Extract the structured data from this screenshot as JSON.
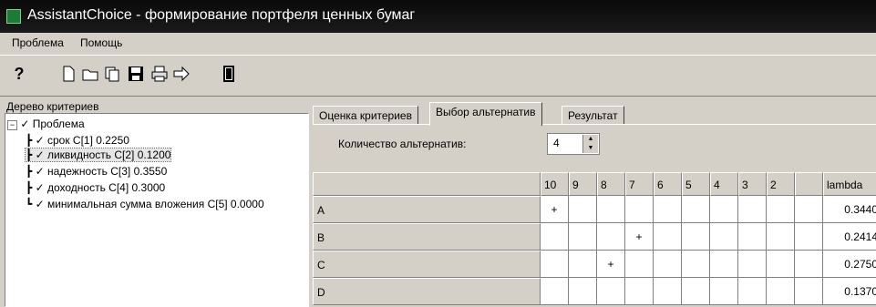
{
  "window": {
    "title": "AssistantChoice - формирование портфеля ценных бумаг"
  },
  "menu": [
    "Проблема",
    "Помощь"
  ],
  "toolbar": {
    "buttons": [
      "help-icon",
      "new-icon",
      "open-icon",
      "copy-icon",
      "save-icon",
      "print-icon",
      "export-icon",
      "exit-icon"
    ],
    "help_label": "?"
  },
  "tree_panel": {
    "title": "Дерево критериев",
    "root": "Проблема",
    "items": [
      "срок  C[1]  0.2250",
      "ликвидность  C[2]  0.1200",
      "надежность  C[3]  0.3550",
      "доходность  C[4]  0.3000",
      "минимальная сумма вложения  C[5]  0.0000"
    ],
    "selected_index": 1
  },
  "tabs": [
    "Оценка критериев",
    "Выбор альтернатив",
    "Результат"
  ],
  "active_tab": 1,
  "alternatives": {
    "count_label": "Количество альтернатив:",
    "count_value": "4",
    "columns": [
      "10",
      "9",
      "8",
      "7",
      "6",
      "5",
      "4",
      "3",
      "2",
      "",
      "lambda"
    ],
    "rows": [
      {
        "name": "A",
        "marks": [
          "+",
          "",
          "",
          "",
          "",
          "",
          "",
          "",
          "",
          "",
          "0.3440"
        ]
      },
      {
        "name": "B",
        "marks": [
          "",
          "",
          "",
          "+",
          "",
          "",
          "",
          "",
          "",
          "",
          "0.2414"
        ]
      },
      {
        "name": "C",
        "marks": [
          "",
          "",
          "+",
          "",
          "",
          "",
          "",
          "",
          "",
          "",
          "0.2750"
        ]
      },
      {
        "name": "D",
        "marks": [
          "",
          "",
          "",
          "",
          "",
          "",
          "",
          "",
          "",
          "",
          "0.1370"
        ]
      }
    ]
  }
}
